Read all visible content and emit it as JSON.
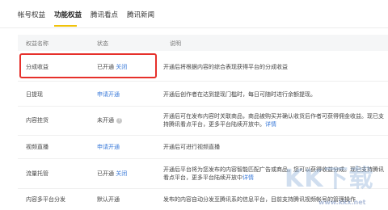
{
  "tabs": [
    "帐号权益",
    "功能权益",
    "腾讯看点",
    "腾讯新闻"
  ],
  "table": {
    "headers": [
      "权益名称",
      "状态",
      "说明"
    ],
    "rows": [
      {
        "name": "分成收益",
        "status": "已开通",
        "action": "关闭",
        "desc": "开通后将根据内容的综合表现获得平台的分成收益"
      },
      {
        "name": "日提现",
        "status": "",
        "action": "申请开通",
        "desc": "开通后创作者在达到提现门槛时，每日可随时进行余额提现。"
      },
      {
        "name": "内容挂货",
        "status": "未开通",
        "action": "",
        "desc": "开通后可在发布内容时关联商品，商品被购买并确认收货后作者可获得佣金收益。现已支持腾讯看点平台，更多平台陆续开放中。",
        "desc_link": "详情",
        "has_help": true
      },
      {
        "name": "视频直播",
        "status": "",
        "action": "申请开通",
        "desc": "开通后可进行视频直播"
      },
      {
        "name": "流量托管",
        "status": "已开通",
        "action": "关闭",
        "desc": "开通后平台将为您发布的内容智能匹配广告或商品，您可以获得收益分成。现已支持腾讯看点平台，更多平台陆续开放中",
        "desc_link": "详情"
      },
      {
        "name": "内容多平台分发",
        "status": "默认开通",
        "action": "",
        "desc": "发布的内容自动分发至腾讯系的信息平台，目前支持腾讯视频帐号的管理操作"
      }
    ]
  },
  "watermark": {
    "main": "KK下载",
    "url": "www.kkx.net"
  },
  "colors": {
    "accent_tab": "#f0c20a",
    "link": "#3a7ad9",
    "highlight": "#e6302b"
  }
}
